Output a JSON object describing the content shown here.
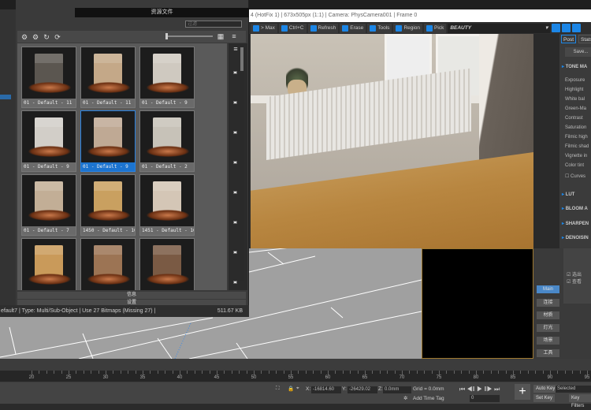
{
  "browser": {
    "title": "资源文件",
    "filter_placeholder": "过滤",
    "tiles": [
      {
        "label": "01 - Default - 11",
        "color": "#5b5650"
      },
      {
        "label": "01 - Default - 11",
        "color": "#c4a888"
      },
      {
        "label": "01 - Default - 9",
        "color": "#cfc9c0"
      },
      {
        "label": "01 - Default - 9",
        "color": "#d2cec8"
      },
      {
        "label": "01 - Default - 9",
        "color": "#bfa994"
      },
      {
        "label": "01 - Default - 2",
        "color": "#c7c2b8"
      },
      {
        "label": "01 - Default - 7",
        "color": "#c2ae96"
      },
      {
        "label": "1450 - Default - 10",
        "color": "#c9a060"
      },
      {
        "label": "1451 - Default - 10",
        "color": "#d4c6b6"
      },
      {
        "label": "",
        "color": "#c99a5a"
      },
      {
        "label": "",
        "color": "#9c7454"
      },
      {
        "label": "",
        "color": "#7a5a44"
      }
    ],
    "selected_index": 4,
    "footer_info": "信息",
    "footer_settings": "设置",
    "status": "efault7 | Type: Multi/Sub-Object | Use 27 Bitmaps (Missing 27) |",
    "size": "511.67 KB"
  },
  "render": {
    "title": "4 (HotFix 1) | 673x505px (1:1) | Camera: PhysCamera001 | Frame 0",
    "toolbar": [
      "> Max",
      "Ctrl+C",
      "Refresh",
      "Erase",
      "Tools",
      "Region",
      "Pick"
    ],
    "channel": "BEAUTY"
  },
  "post": {
    "tabs": [
      "Post",
      "Stats"
    ],
    "save": "Save...",
    "tone": "TONE MA",
    "params": [
      "Exposure",
      "Highlight",
      "White bal",
      "Green-Ma",
      "Contrast",
      "Saturation",
      "Filmic high",
      "Filmic shad",
      "Vignette in",
      "Color tint"
    ],
    "curves": "Curves",
    "sections": [
      "LUT",
      "BLOOM A",
      "SHARPEN",
      "DENOISIN"
    ]
  },
  "sidepanel": {
    "buttons": [
      "Main",
      "连接",
      "材质",
      "灯光",
      "场景",
      "工具"
    ],
    "checks": [
      "选出",
      "查看"
    ]
  },
  "timeline": {
    "ticks": [
      20,
      25,
      30,
      35,
      40,
      45,
      50,
      55,
      60,
      65,
      70,
      75,
      80,
      85,
      90,
      95
    ]
  },
  "bottom": {
    "x": "-16814.60",
    "y": "-26429.02",
    "z": "0.0mm",
    "grid": "Grid = 0.0mm",
    "add_time_tag": "Add Time Tag",
    "frame": "0",
    "auto_key": "Auto Key",
    "set_key": "Set Key",
    "selected": "Selected",
    "key_filters": "Key Filters"
  }
}
